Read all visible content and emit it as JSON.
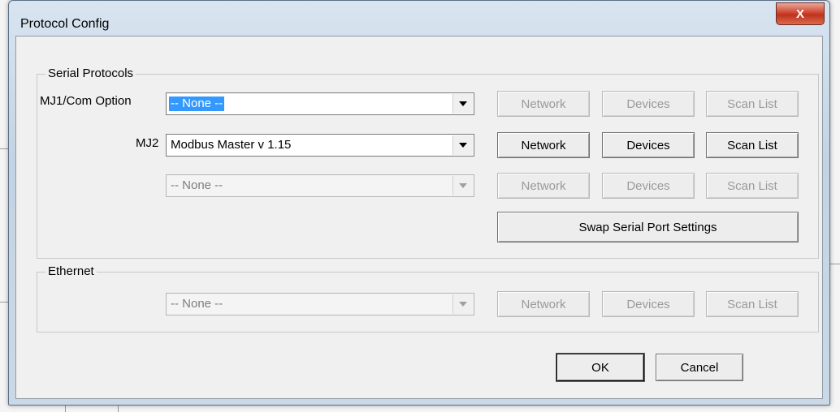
{
  "window": {
    "title": "Protocol Config",
    "close_label": "X"
  },
  "serial": {
    "group_label": "Serial Protocols",
    "rows": [
      {
        "label": "MJ1/Com Option",
        "value": "-- None --",
        "network": "Network",
        "devices": "Devices",
        "scan": "Scan List"
      },
      {
        "label": "MJ2",
        "value": "Modbus Master  v 1.15",
        "network": "Network",
        "devices": "Devices",
        "scan": "Scan List"
      },
      {
        "label": "",
        "value": "-- None --",
        "network": "Network",
        "devices": "Devices",
        "scan": "Scan List"
      }
    ],
    "swap_label": "Swap Serial Port Settings"
  },
  "ethernet": {
    "group_label": "Ethernet",
    "value": "-- None --",
    "network": "Network",
    "devices": "Devices",
    "scan": "Scan List"
  },
  "footer": {
    "ok": "OK",
    "cancel": "Cancel"
  }
}
